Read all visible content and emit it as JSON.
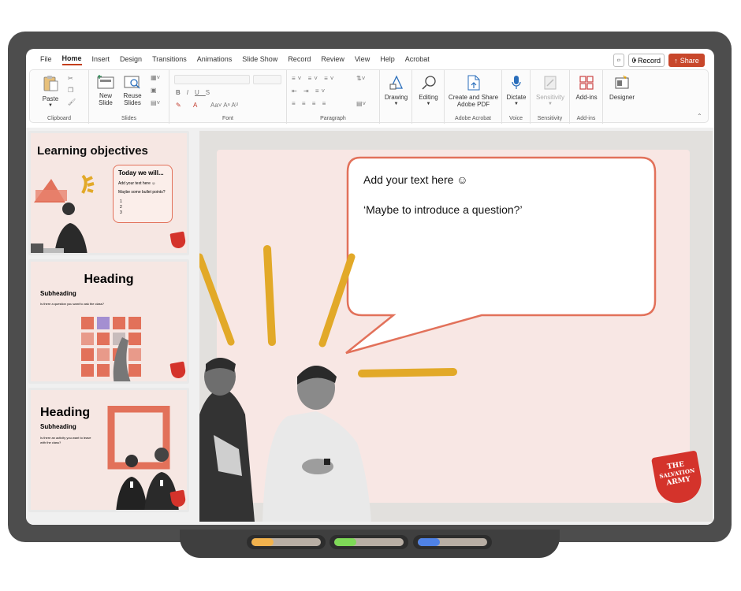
{
  "ribbon": {
    "tabs": [
      "File",
      "Home",
      "Insert",
      "Design",
      "Transitions",
      "Animations",
      "Slide Show",
      "Record",
      "Review",
      "View",
      "Help",
      "Acrobat"
    ],
    "active_tab": "Home",
    "record_label": "Record",
    "share_label": "Share",
    "clipboard": {
      "paste": "Paste",
      "group": "Clipboard"
    },
    "slides": {
      "new_slide": "New Slide",
      "reuse_slides": "Reuse Slides",
      "group": "Slides"
    },
    "font": {
      "group": "Font"
    },
    "paragraph": {
      "group": "Paragraph"
    },
    "drawing": "Drawing",
    "editing": "Editing",
    "acrobat": {
      "create_share": "Create and Share Adobe PDF",
      "group": "Adobe Acrobat"
    },
    "voice": {
      "dictate": "Dictate",
      "group": "Voice"
    },
    "sensitivity": {
      "button": "Sensitivity",
      "group": "Sensitivity"
    },
    "addins": {
      "button": "Add-ins",
      "group": "Add-ins"
    },
    "designer": "Designer"
  },
  "thumbnails": [
    {
      "title": "Learning objectives",
      "box_title": "Today we will...",
      "box_line1": "Add your text here ☺",
      "box_line2": "Maybe some bullet points?",
      "bullets": [
        "1",
        "2",
        "3"
      ]
    },
    {
      "title": "Heading",
      "subheading": "Subheading",
      "text": "Is there a question you want to ask the class?"
    },
    {
      "title": "Heading",
      "subheading": "Subheading",
      "text": "Is there an activity you want to leave with the class?"
    }
  ],
  "main_slide": {
    "bubble_line1": "Add your text here ☺",
    "bubble_line2": "‘Maybe to introduce a question?’",
    "logo_lines": [
      "THE",
      "SALVATION",
      "ARMY"
    ]
  },
  "colors": {
    "accent": "#c43e1c",
    "share": "#c8472b",
    "mustard": "#e2a928",
    "coral": "#e2715a",
    "slide_bg": "#f8e7e4",
    "frame": "#4d4d4d"
  },
  "markers": [
    {
      "color": "#f2b24d",
      "icon": "marker-orange"
    },
    {
      "color": "#7ed957",
      "icon": "marker-green"
    },
    {
      "color": "#4f82e6",
      "icon": "marker-blue"
    }
  ]
}
